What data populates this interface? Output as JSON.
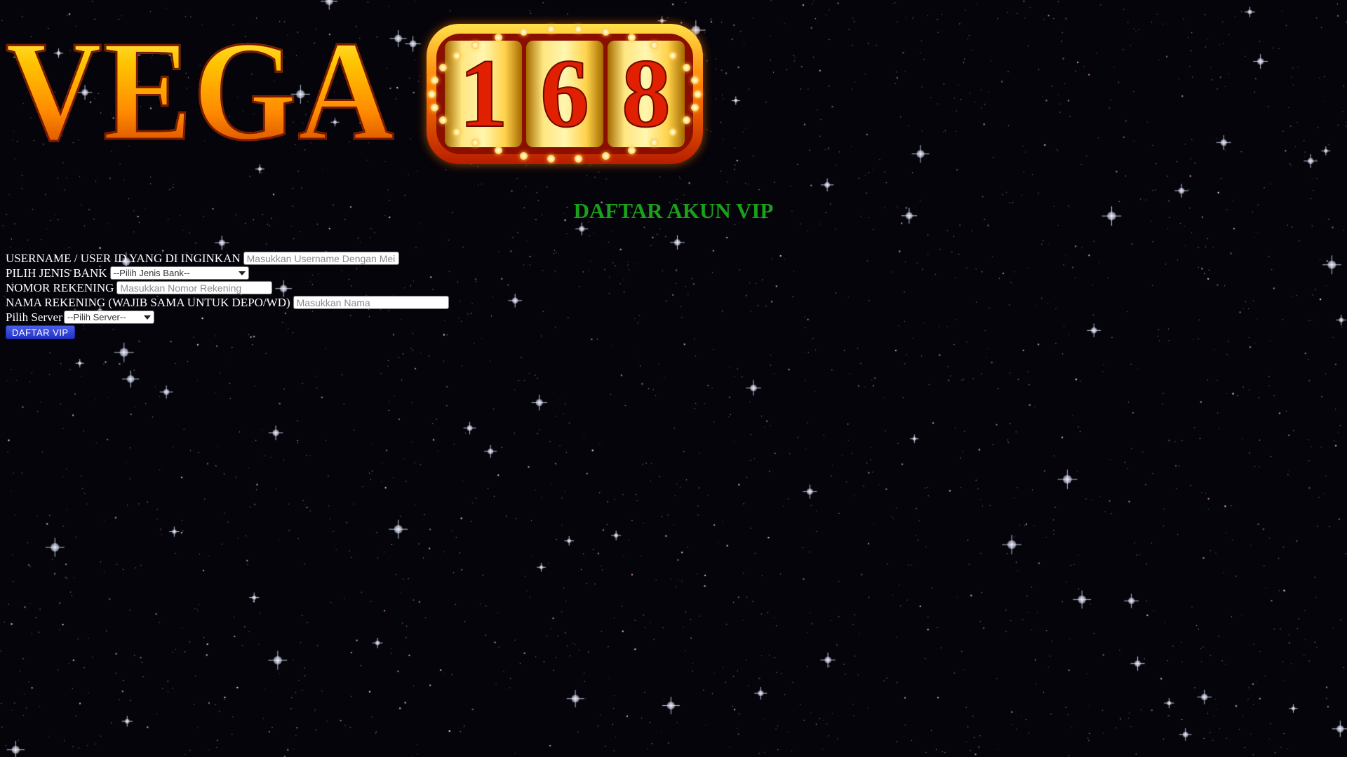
{
  "logo": {
    "word": "VEGA",
    "badge_digits": [
      "1",
      "6",
      "8"
    ]
  },
  "page": {
    "title": "DAFTAR AKUN VIP"
  },
  "form": {
    "username": {
      "label": "USERNAME / USER ID YANG DI INGINKAN",
      "placeholder": "Masukkan Username Dengan Mei"
    },
    "bank": {
      "label": "PILIH JENIS BANK",
      "selected": "--Pilih Jenis Bank--"
    },
    "account_number": {
      "label": "NOMOR REKENING",
      "placeholder": "Masukkan Nomor Rekening"
    },
    "account_name": {
      "label": "NAMA REKENING (WAJIB SAMA UNTUK DEPO/WD)",
      "placeholder": "Masukkan Nama"
    },
    "server": {
      "label": "Pilih Server",
      "selected": "--Pilih Server--"
    },
    "submit_label": "DAFTAR VIP"
  },
  "colors": {
    "background": "#05040a",
    "title": "#1aa01a",
    "button": "#2231c8",
    "logo_gold": "#ffc400",
    "logo_red": "#e02000"
  }
}
